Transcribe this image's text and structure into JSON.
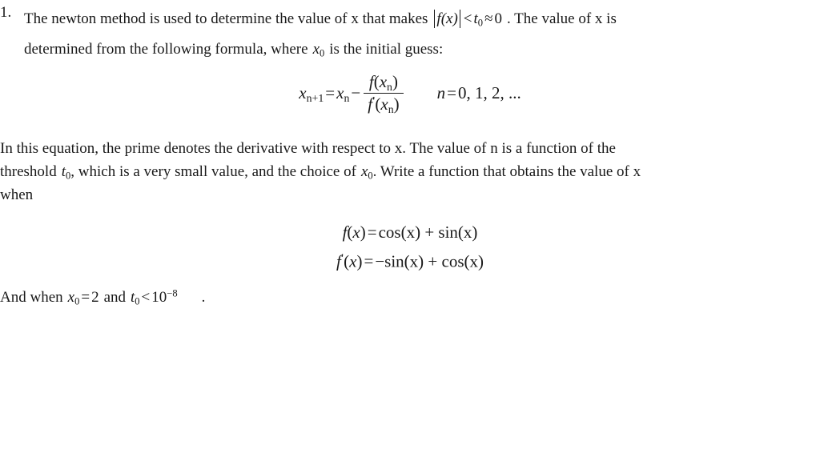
{
  "document": {
    "problem_number": "1.",
    "intro": {
      "line1_a": "The newton method is used to determine the value of x that makes",
      "math_inline": {
        "f_of_x": "f(x)",
        "less_than": "<",
        "t": "t",
        "t_sub": "0",
        "approx": "≈",
        "zero": "0"
      },
      "line1_b": ". The value of x is",
      "line2_a": "determined from the following formula, where",
      "line2_math": {
        "x": "x",
        "x_sub": "0"
      },
      "line2_b": "is the initial guess:"
    },
    "main_equation": {
      "lhs_var": "x",
      "lhs_sub": "n+1",
      "equals": "=",
      "rhs_var": "x",
      "rhs_sub": "n",
      "minus": "−",
      "numerator": {
        "f": "f",
        "open": "(",
        "var": "x",
        "sub": "n",
        "close": ")"
      },
      "denominator": {
        "f": "f",
        "prime": "′",
        "open": "(",
        "var": "x",
        "sub": "n",
        "close": ")"
      },
      "condition": {
        "n": "n",
        "equals": "=",
        "values": "0, 1, 2, ..."
      }
    },
    "paragraph": {
      "line1": "In this equation, the prime denotes the derivative with respect to x. The value of n is a function of the",
      "line2_a": "threshold",
      "line2_math_t": {
        "t": "t",
        "sub": "0"
      },
      "line2_b": ", which is a very small value, and the choice of",
      "line2_math_x": {
        "x": "x",
        "sub": "0"
      },
      "line2_c": ". Write a function that obtains the value of x",
      "line3": "when"
    },
    "function_definitions": [
      {
        "lhs": {
          "f": "f",
          "prime": "",
          "open": "(",
          "var": "x",
          "close": ")"
        },
        "equals": "=",
        "rhs": "cos(x) + sin(x)",
        "terms": [
          {
            "fn": "cos",
            "arg": "x",
            "sign": ""
          },
          {
            "fn": "sin",
            "arg": "x",
            "sign": "+"
          }
        ]
      },
      {
        "lhs": {
          "f": "f",
          "prime": "′",
          "open": "(",
          "var": "x",
          "close": ")"
        },
        "equals": "=",
        "rhs": "−sin(x) + cos(x)",
        "terms": [
          {
            "fn": "sin",
            "arg": "x",
            "sign": "−"
          },
          {
            "fn": "cos",
            "arg": "x",
            "sign": "+"
          }
        ]
      }
    ],
    "closing": {
      "text_a": "And when",
      "x_var": "x",
      "x_sub": "0",
      "x_equals": "=",
      "x_value": "2",
      "text_b": "and",
      "t_var": "t",
      "t_sub": "0",
      "t_rel": "<",
      "t_base": "10",
      "t_exp": "−8",
      "text_c": "."
    }
  },
  "style": {
    "background_color": "#ffffff",
    "text_color": "#191919"
  }
}
